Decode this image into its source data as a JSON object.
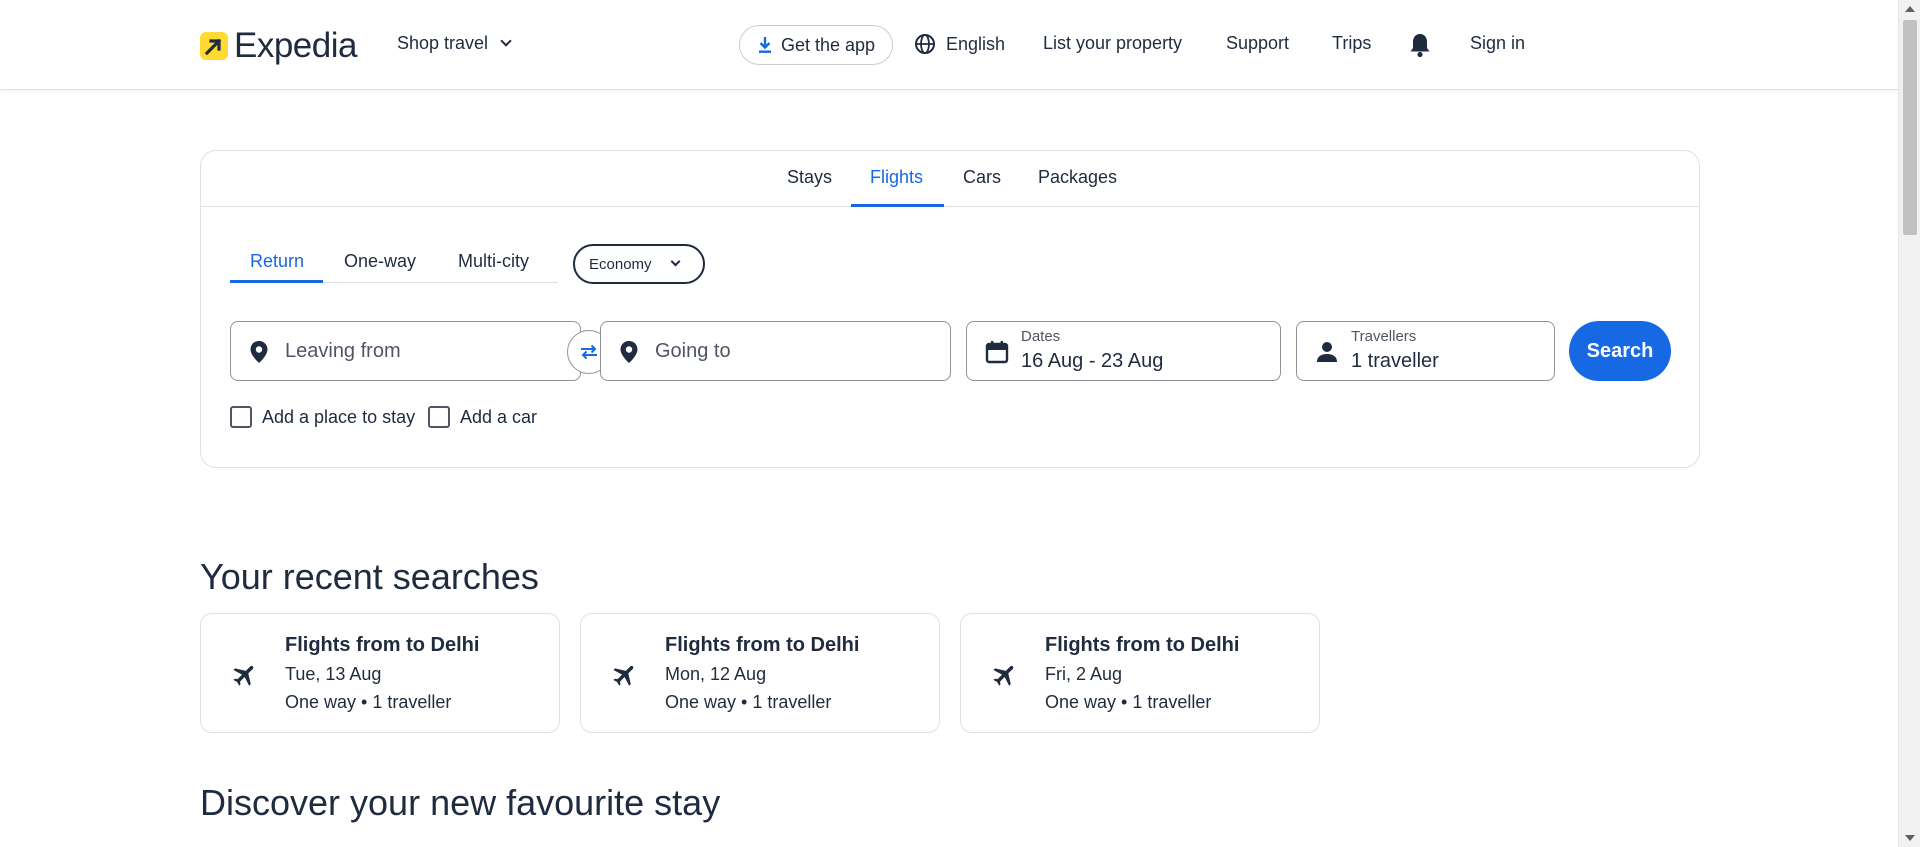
{
  "header": {
    "logo_text": "Expedia",
    "shop_travel": "Shop travel",
    "get_app": "Get the app",
    "language": "English",
    "list_property": "List your property",
    "support": "Support",
    "trips": "Trips",
    "sign_in": "Sign in"
  },
  "search": {
    "tabs": [
      {
        "label": "Stays"
      },
      {
        "label": "Flights",
        "active": true
      },
      {
        "label": "Cars"
      },
      {
        "label": "Packages"
      }
    ],
    "trip_types": [
      {
        "label": "Return",
        "active": true
      },
      {
        "label": "One-way"
      },
      {
        "label": "Multi-city"
      }
    ],
    "cabin_class": "Economy",
    "leaving_placeholder": "Leaving from",
    "going_placeholder": "Going to",
    "dates_label": "Dates",
    "dates_value": "16 Aug - 23 Aug",
    "travellers_label": "Travellers",
    "travellers_value": "1 traveller",
    "search_button": "Search",
    "add_stay": "Add a place to stay",
    "add_car": "Add a car"
  },
  "recent": {
    "title": "Your recent searches",
    "items": [
      {
        "title": "Flights from to Delhi",
        "date": "Tue, 13 Aug",
        "detail": "One way • 1 traveller"
      },
      {
        "title": "Flights from to Delhi",
        "date": "Mon, 12 Aug",
        "detail": "One way • 1 traveller"
      },
      {
        "title": "Flights from to Delhi",
        "date": "Fri, 2 Aug",
        "detail": "One way • 1 traveller"
      }
    ]
  },
  "discover": {
    "title": "Discover your new favourite stay"
  },
  "colors": {
    "accent": "#1668e3",
    "text": "#1f2b3e",
    "logo_yellow": "#fddb32"
  },
  "icons": [
    "expedia-logo-icon",
    "chevron-down-icon",
    "download-icon",
    "globe-icon",
    "bell-icon",
    "location-pin-icon",
    "swap-icon",
    "calendar-icon",
    "person-icon",
    "airplane-icon"
  ]
}
